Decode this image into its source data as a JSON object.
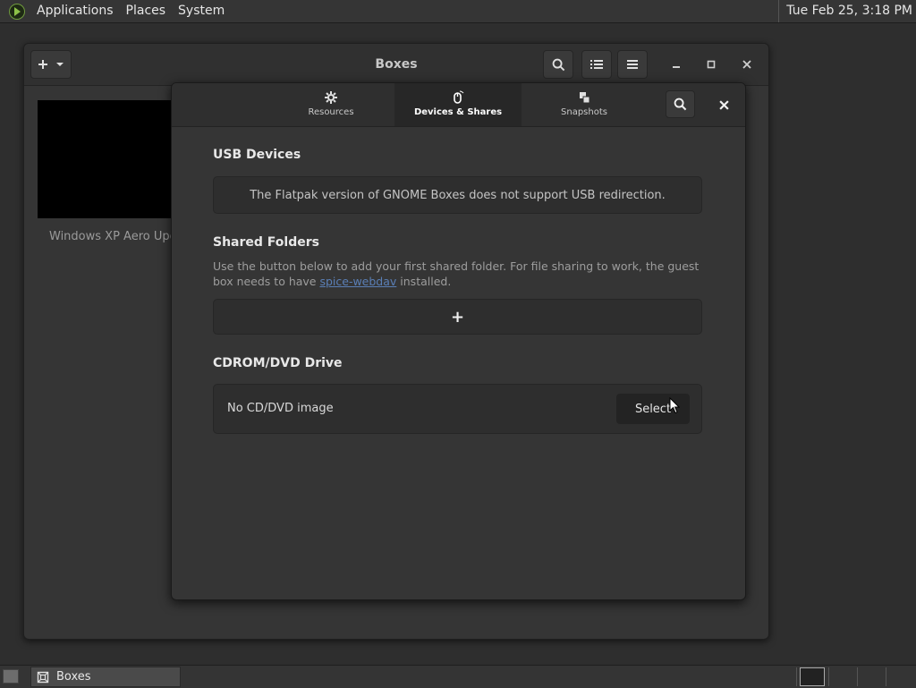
{
  "top_panel": {
    "menus": [
      "Applications",
      "Places",
      "System"
    ],
    "clock": "Tue Feb 25,  3:18 PM"
  },
  "window": {
    "title": "Boxes",
    "vm_label": "Windows XP Aero Upd"
  },
  "dialog": {
    "tabs": [
      {
        "label": "Resources",
        "icon": "gear-icon"
      },
      {
        "label": "Devices & Shares",
        "icon": "mouse-icon"
      },
      {
        "label": "Snapshots",
        "icon": "snapshots-icon"
      }
    ],
    "active_tab": "Devices & Shares",
    "usb": {
      "title": "USB Devices",
      "message": "The Flatpak version of GNOME Boxes does not support USB redirection."
    },
    "shared": {
      "title": "Shared Folders",
      "desc_before": "Use the button below to add your first shared folder. For file sharing to work, the guest box needs to have ",
      "link": "spice-webdav",
      "desc_after": " installed.",
      "add_label": "+"
    },
    "cdrom": {
      "title": "CDROM/DVD Drive",
      "label": "No CD/DVD image",
      "select_label": "Select"
    }
  },
  "taskbar": {
    "task_label": "Boxes"
  }
}
